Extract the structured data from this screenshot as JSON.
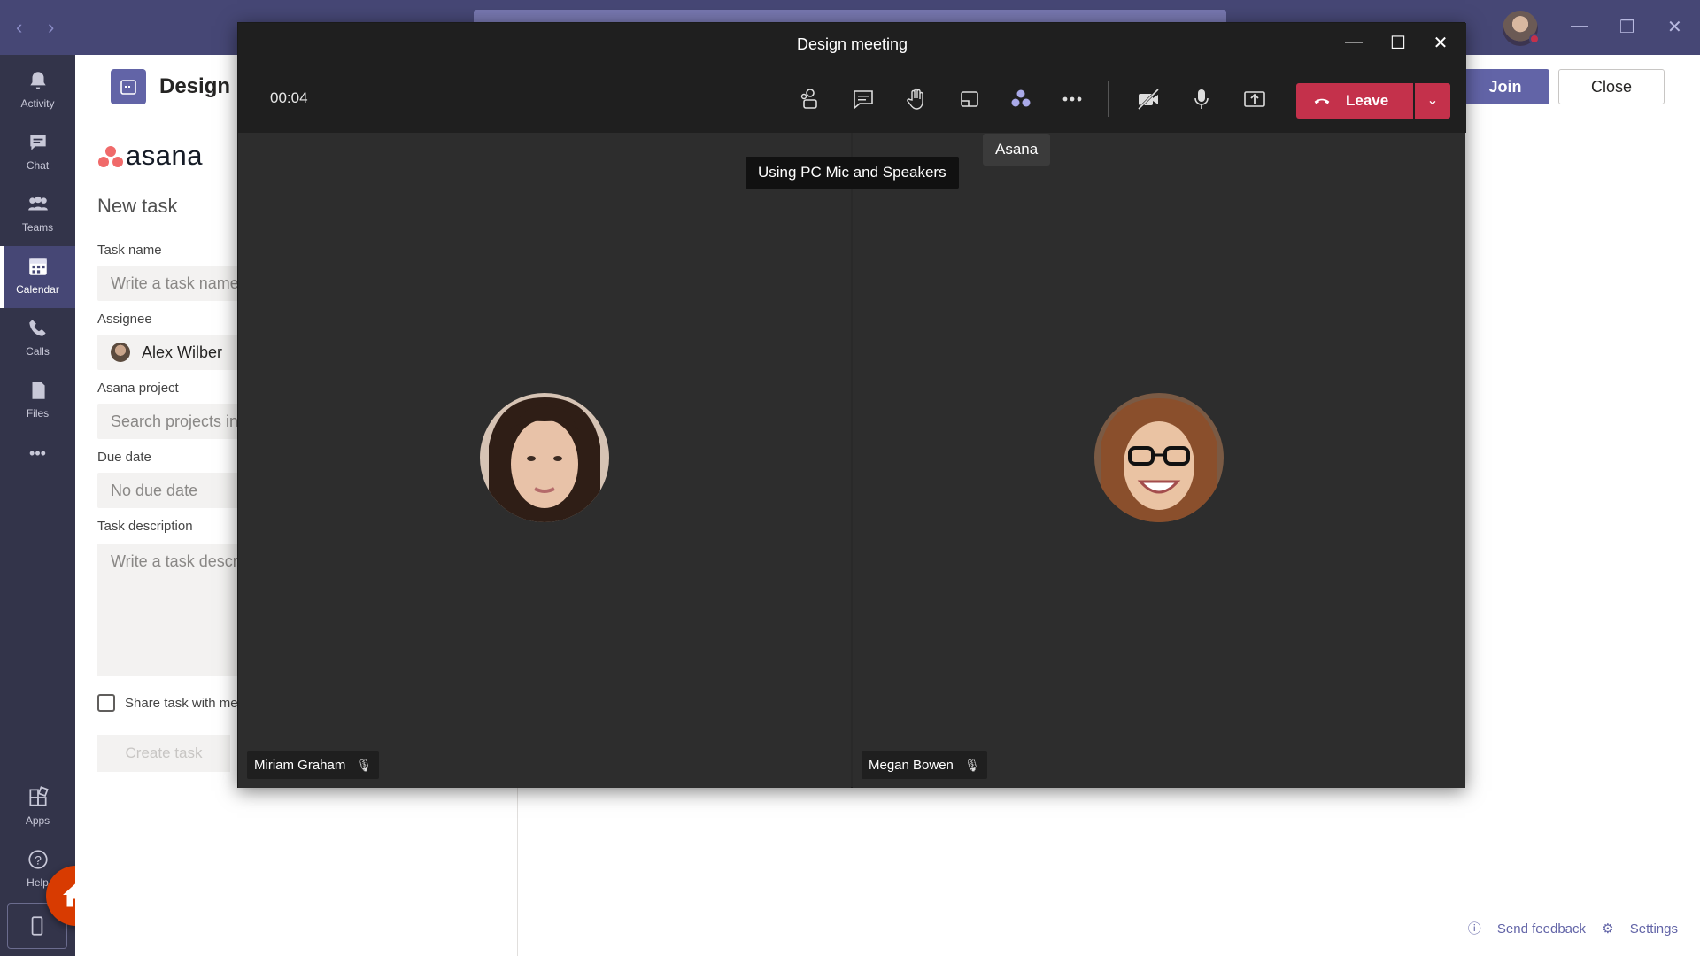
{
  "teams_rail": {
    "items": [
      {
        "label": "Activity"
      },
      {
        "label": "Chat"
      },
      {
        "label": "Teams"
      },
      {
        "label": "Calendar"
      },
      {
        "label": "Calls"
      },
      {
        "label": "Files"
      }
    ],
    "more": "•••",
    "bottom": [
      {
        "label": "Apps"
      },
      {
        "label": "Help"
      }
    ]
  },
  "background_page": {
    "meeting_title": "Design meeting",
    "join_label": "Join",
    "close_label": "Close",
    "asana": {
      "logo_text": "asana",
      "heading": "New task",
      "task_name_label": "Task name",
      "task_name_placeholder": "Write a task name",
      "assignee_label": "Assignee",
      "assignee_value": "Alex Wilber",
      "project_label": "Asana project",
      "project_placeholder": "Search projects in",
      "due_date_label": "Due date",
      "due_date_placeholder": "No due date",
      "description_label": "Task description",
      "description_placeholder": "Write a task description",
      "share_label": "Share task with meeting",
      "create_button": "Create task"
    },
    "footer": {
      "send_feedback": "Send feedback",
      "settings": "Settings"
    }
  },
  "meeting": {
    "window_title": "Design meeting",
    "timer": "00:04",
    "leave_label": "Leave",
    "tooltip_audio": "Using PC Mic and Speakers",
    "tooltip_app": "Asana",
    "participants": [
      {
        "name": "Miriam Graham",
        "muted": true
      },
      {
        "name": "Megan Bowen",
        "muted": true
      }
    ]
  },
  "colors": {
    "brand": "#464775",
    "accent": "#6264a7",
    "leave": "#c4314b",
    "home": "#d83b01"
  }
}
